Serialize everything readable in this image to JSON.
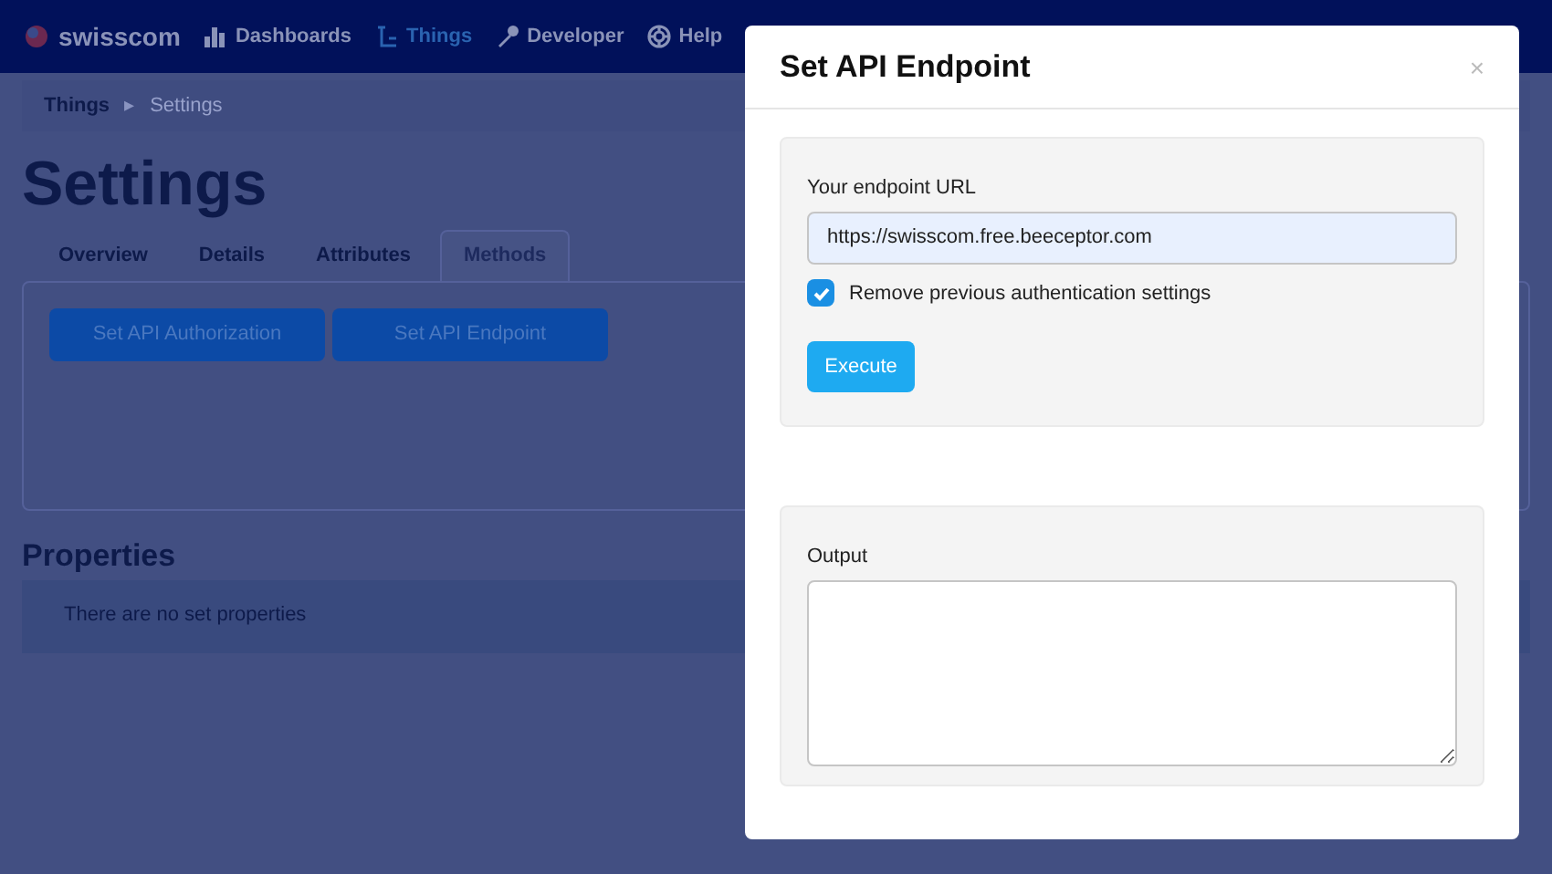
{
  "nav": {
    "brand": "swisscom",
    "items": [
      {
        "label": "Dashboards",
        "selected": false
      },
      {
        "label": "Things",
        "selected": true
      },
      {
        "label": "Developer",
        "selected": false
      },
      {
        "label": "Help",
        "selected": false
      }
    ]
  },
  "breadcrumb": [
    {
      "label": "Things",
      "current": false
    },
    {
      "label": "Settings",
      "current": true
    }
  ],
  "breadcrumb_separator": "▸",
  "page_title": "Settings",
  "tabs": [
    {
      "label": "Overview",
      "selected": false
    },
    {
      "label": "Details",
      "selected": false
    },
    {
      "label": "Attributes",
      "selected": false
    },
    {
      "label": "Methods",
      "selected": true
    }
  ],
  "method_buttons": [
    "Set API Authorization",
    "Set API Endpoint"
  ],
  "properties": {
    "title": "Properties",
    "empty_text": "There are no set properties"
  },
  "modal": {
    "title": "Set API Endpoint",
    "close": "×",
    "url_label": "Your endpoint URL",
    "url_value": "https://swisscom.free.beeceptor.com",
    "remove_auth": {
      "label": "Remove previous authentication settings",
      "checked": true
    },
    "execute": "Execute",
    "output_label": "Output"
  }
}
